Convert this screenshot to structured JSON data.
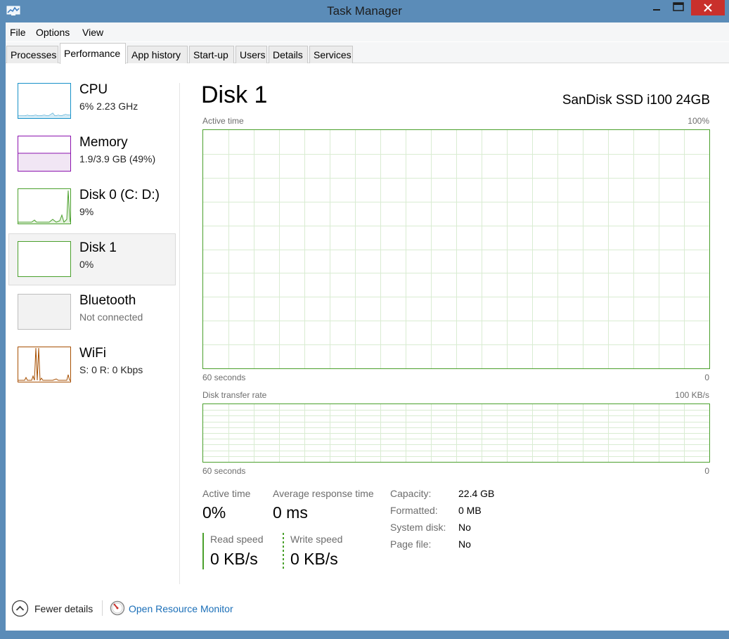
{
  "window": {
    "title": "Task Manager",
    "icon": "task-manager-icon",
    "controls": [
      "minimize-icon",
      "maximize-icon",
      "close-icon"
    ]
  },
  "menu": [
    "File",
    "Options",
    "View"
  ],
  "tabs": [
    {
      "label": "Processes",
      "active": false
    },
    {
      "label": "Performance",
      "active": true
    },
    {
      "label": "App history",
      "active": false
    },
    {
      "label": "Start-up",
      "active": false
    },
    {
      "label": "Users",
      "active": false
    },
    {
      "label": "Details",
      "active": false
    },
    {
      "label": "Services",
      "active": false
    }
  ],
  "sidebar": {
    "items": [
      {
        "title": "CPU",
        "subtitle": "6%  2.23 GHz",
        "color": "#1791c8"
      },
      {
        "title": "Memory",
        "subtitle": "1.9/3.9 GB (49%)",
        "color": "#8b12ae"
      },
      {
        "title": "Disk 0 (C: D:)",
        "subtitle": "9%",
        "color": "#4aa02c"
      },
      {
        "title": "Disk 1",
        "subtitle": "0%",
        "color": "#4aa02c",
        "selected": true
      },
      {
        "title": "Bluetooth",
        "subtitle": "Not connected",
        "color": "#a0a0a0"
      },
      {
        "title": "WiFi",
        "subtitle": "S: 0  R: 0 Kbps",
        "color": "#a74f01"
      }
    ]
  },
  "main": {
    "heading": "Disk 1",
    "model": "SanDisk SSD i100 24GB",
    "active_graph": {
      "label": "Active time",
      "max": "100%",
      "time": "60 seconds",
      "min": "0"
    },
    "transfer_graph": {
      "label": "Disk transfer rate",
      "max": "100 KB/s",
      "time": "60 seconds",
      "min": "0"
    },
    "stats": {
      "active_time_label": "Active time",
      "active_time_value": "0%",
      "response_label": "Average response time",
      "response_value": "0 ms",
      "read_label": "Read speed",
      "read_value": "0 KB/s",
      "write_label": "Write speed",
      "write_value": "0 KB/s"
    },
    "properties": [
      {
        "key": "Capacity:",
        "value": "22.4 GB"
      },
      {
        "key": "Formatted:",
        "value": "0 MB"
      },
      {
        "key": "System disk:",
        "value": "No"
      },
      {
        "key": "Page file:",
        "value": "No"
      }
    ]
  },
  "footer": {
    "fewer_details": "Fewer details",
    "open_monitor": "Open Resource Monitor",
    "link_color": "#1b6fb8"
  },
  "colors": {
    "disk_green": "#4aa02c",
    "grid_green": "#d9ecd2",
    "frame_blue": "#5b8cb8",
    "close_red": "#c9302c"
  }
}
